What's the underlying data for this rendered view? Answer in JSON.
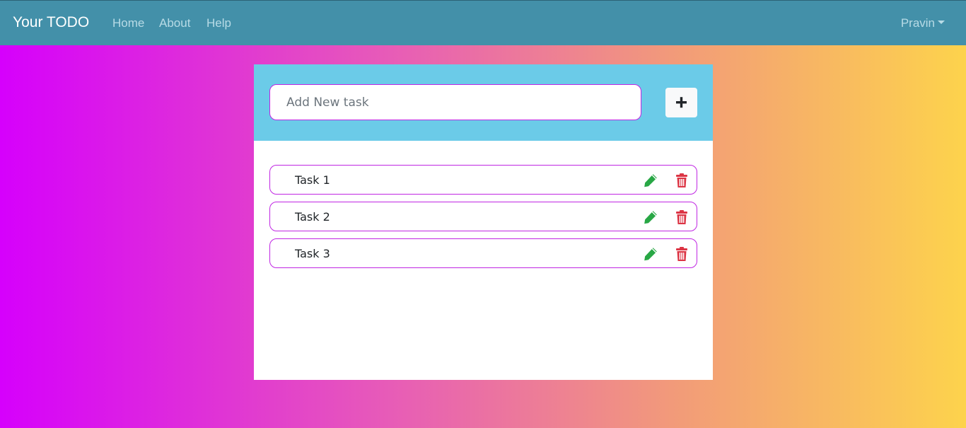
{
  "navbar": {
    "brand": "Your TODO",
    "links": [
      {
        "label": "Home"
      },
      {
        "label": "About"
      },
      {
        "label": "Help"
      }
    ],
    "user": "Pravin"
  },
  "new_task": {
    "placeholder": "Add New task",
    "value": "",
    "add_icon": "plus-icon"
  },
  "tasks": [
    {
      "label": "Task 1",
      "edit_icon": "pencil-icon",
      "delete_icon": "trash-icon"
    },
    {
      "label": "Task 2",
      "edit_icon": "pencil-icon",
      "delete_icon": "trash-icon"
    },
    {
      "label": "Task 3",
      "edit_icon": "pencil-icon",
      "delete_icon": "trash-icon"
    }
  ],
  "colors": {
    "navbar": "#4390a9",
    "card_header": "#6bcbe8",
    "task_border": "#c026e3",
    "edit": "#28a745",
    "delete": "#dc3545"
  }
}
